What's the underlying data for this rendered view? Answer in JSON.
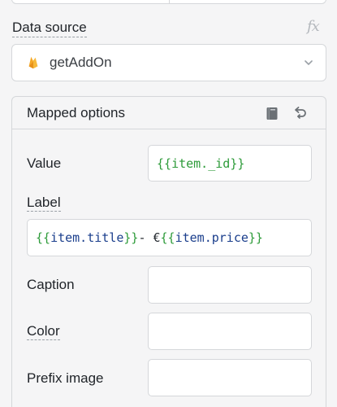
{
  "data_source": {
    "label": "Data source",
    "fx_label": "fx",
    "selected": "getAddOn"
  },
  "mapped_options": {
    "title": "Mapped options",
    "fields": {
      "value": {
        "label": "Value",
        "open": "{{ ",
        "expr": "item._id",
        "close": " }}"
      },
      "label": {
        "label": "Label",
        "open": "{{ ",
        "expr1": "item.title",
        "mid_close": " }}",
        "sep": " - €",
        "open2": "{{",
        "expr2": "item.price",
        "close2": "}}"
      },
      "caption": {
        "label": "Caption",
        "value": ""
      },
      "color": {
        "label": "Color",
        "value": ""
      },
      "prefix_image": {
        "label": "Prefix image",
        "value": ""
      }
    }
  },
  "icons": {
    "flame": "firebase-flame-icon",
    "chevron": "chevron-down-icon",
    "book": "book-icon",
    "undo": "undo-icon"
  },
  "colors": {
    "binding_green": "#2e9b3a",
    "binding_blue": "#1a3e8c",
    "border": "#d5d7da",
    "flame": "#f5a623"
  }
}
